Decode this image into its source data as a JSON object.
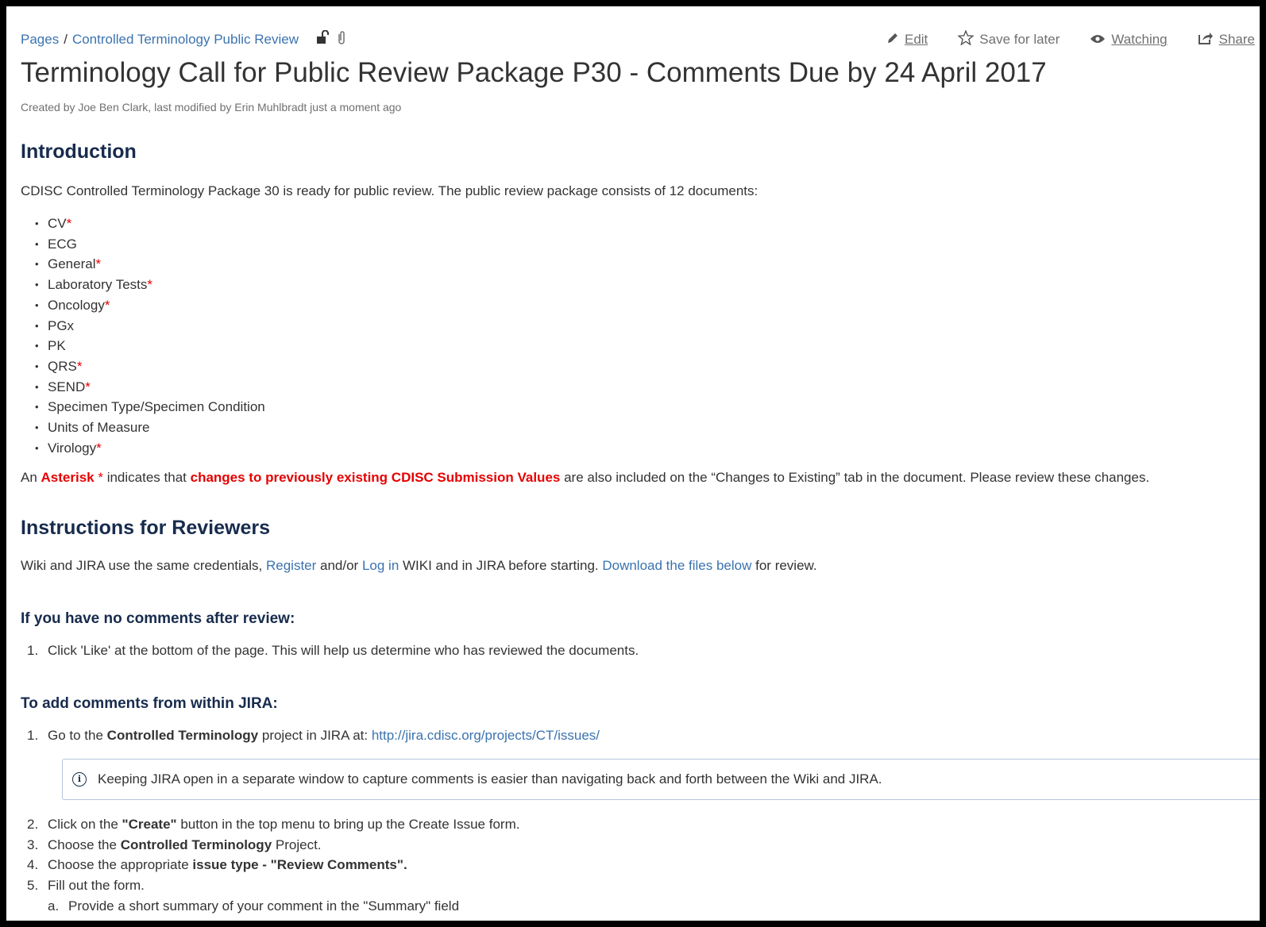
{
  "breadcrumb": {
    "root": "Pages",
    "separator": "/",
    "parent": "Controlled Terminology Public Review"
  },
  "actions": {
    "edit": "Edit",
    "save_for_later": "Save for later",
    "watching": "Watching",
    "share": "Share"
  },
  "page": {
    "title": "Terminology Call for Public Review Package P30 - Comments Due by 24 April 2017",
    "byline": "Created by Joe Ben Clark, last modified by Erin Muhlbradt just a moment ago"
  },
  "intro": {
    "heading": "Introduction",
    "text": "CDISC Controlled Terminology Package 30 is ready for public review. The public review package consists of 12 documents:",
    "documents": [
      {
        "name": "CV",
        "mark": "*"
      },
      {
        "name": "ECG",
        "mark": ""
      },
      {
        "name": "General",
        "mark": "*"
      },
      {
        "name": "Laboratory Tests",
        "mark": "*"
      },
      {
        "name": "Oncology",
        "mark": "*"
      },
      {
        "name": "PGx",
        "mark": ""
      },
      {
        "name": "PK",
        "mark": ""
      },
      {
        "name": "QRS",
        "mark": "*"
      },
      {
        "name": "SEND",
        "mark": "*"
      },
      {
        "name": "Specimen Type/Specimen Condition",
        "mark": ""
      },
      {
        "name": "Units of Measure",
        "mark": ""
      },
      {
        "name": "Virology",
        "mark": "*"
      }
    ],
    "asterisk_note": {
      "prefix": "An ",
      "asterisk_word": "Asterisk",
      "asterisk_symbol": " * ",
      "middle": "indicates that ",
      "highlight": "changes to previously existing CDISC Submission Values",
      "suffix": " are also included on the “Changes to Existing” tab in the document.  Please review these changes."
    }
  },
  "instructions": {
    "heading": "Instructions for Reviewers",
    "p_start": "Wiki and JIRA use the same credentials, ",
    "register_link": "Register",
    "p_and": " and/or ",
    "login_link": "Log in",
    "p_mid": " WIKI and in JIRA before starting. ",
    "download_link": "Download the files below",
    "p_end": " for review."
  },
  "no_comments": {
    "heading": "If you have no comments after review:",
    "steps": [
      {
        "num": "1.",
        "text": "Click 'Like' at the bottom of the page. This will help us determine who has reviewed the documents."
      }
    ]
  },
  "jira": {
    "heading": "To add comments from within JIRA:",
    "step1": {
      "num": "1.",
      "pre": "Go to the ",
      "bold": "Controlled Terminology",
      "mid": " project in JIRA at: ",
      "link": "http://jira.cdisc.org/projects/CT/issues/"
    },
    "info": "Keeping JIRA open in a separate window to capture comments is easier than navigating back and forth between the Wiki and JIRA.",
    "step2": {
      "num": "2.",
      "pre": "Click on the ",
      "bold": "\"Create\"",
      "post": " button in the top menu to bring up the Create Issue form."
    },
    "step3": {
      "num": "3.",
      "pre": "Choose the ",
      "bold": "Controlled Terminology",
      "post": " Project."
    },
    "step4": {
      "num": "4.",
      "pre": "Choose the appropriate ",
      "bold": "issue type - \"Review Comments\"."
    },
    "step5": {
      "num": "5.",
      "text": "Fill out the form."
    },
    "substep_a": {
      "num": "a.",
      "text": "Provide a short summary of your comment in the \"Summary\" field"
    }
  }
}
